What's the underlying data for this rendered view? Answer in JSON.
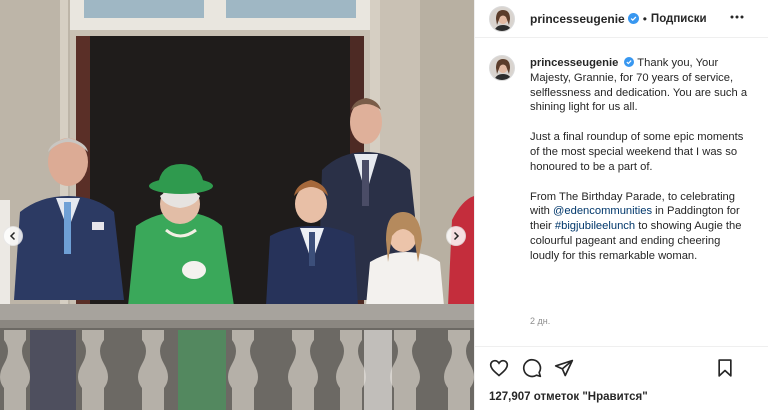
{
  "post": {
    "username": "princesseugenie",
    "follow_label": "Подписки",
    "caption": {
      "p1_after_user": " Thank you, Your Majesty, Grannie, for 70 years of service, selflessness and dedication. You are such a shining light for us all.",
      "p2": "Just a final roundup of some epic moments of the most special weekend that I was so honoured to be a part of.",
      "p3_before_mention": "From The Birthday Parade, to celebrating with ",
      "mention": "@edencommunities",
      "p3_between": " in Paddington for their ",
      "hashtag": "#bigjubileelunch",
      "p3_after_hashtag": " to showing Augie the colourful pageant and ending cheering loudly for this remarkable woman."
    },
    "timestamp": "2 дн.",
    "likes": "127,907 отметок \"Нравится\""
  },
  "icons": {
    "verified": "verified-badge-icon",
    "more": "more-options-icon",
    "like": "heart-icon",
    "comment": "comment-icon",
    "share": "share-icon",
    "save": "bookmark-icon",
    "prev": "chevron-left-icon",
    "next": "chevron-right-icon"
  },
  "colors": {
    "verified": "#3897f0",
    "link": "#00376b",
    "muted": "#8e8e8e",
    "border": "#efefef"
  }
}
